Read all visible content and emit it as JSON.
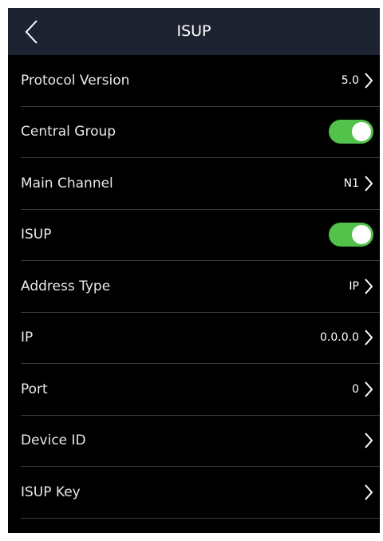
{
  "header": {
    "title": "ISUP",
    "back_icon": "chevron-left-icon"
  },
  "settings": [
    {
      "label": "Protocol Version",
      "type": "nav",
      "value": "5.0"
    },
    {
      "label": "Central Group",
      "type": "toggle",
      "on": true
    },
    {
      "label": "Main Channel",
      "type": "nav",
      "value": "N1"
    },
    {
      "label": "ISUP",
      "type": "toggle",
      "on": true
    },
    {
      "label": "Address Type",
      "type": "nav",
      "value": "IP"
    },
    {
      "label": "IP",
      "type": "nav",
      "value": "0.0.0.0"
    },
    {
      "label": "Port",
      "type": "nav",
      "value": "0"
    },
    {
      "label": "Device ID",
      "type": "nav",
      "value": ""
    },
    {
      "label": "ISUP Key",
      "type": "nav",
      "value": ""
    }
  ],
  "colors": {
    "header_bg": "#1e2331",
    "background": "#000000",
    "toggle_on": "#52c24a"
  }
}
